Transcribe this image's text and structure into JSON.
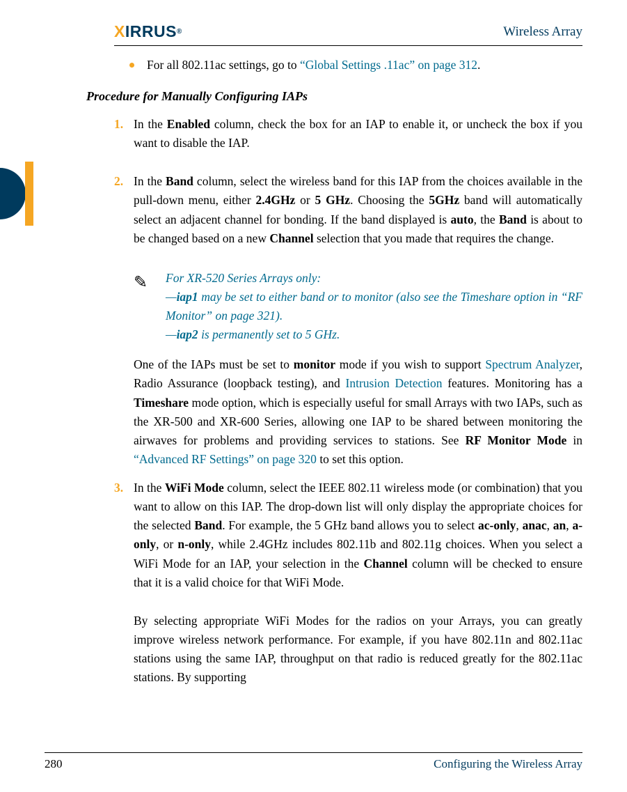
{
  "header": {
    "brand": "XIRRUS",
    "title": "Wireless Array"
  },
  "bullet1": {
    "prefix": "For all 802.11ac settings, go to ",
    "link": "“Global Settings .11ac” on page 312",
    "suffix": "."
  },
  "subhead": "Procedure for Manually Configuring IAPs",
  "step1": {
    "num": "1.",
    "t1": "In the ",
    "b1": "Enabled",
    "t2": " column, check the box for an IAP to enable it, or uncheck the box if you want to disable the IAP."
  },
  "step2": {
    "num": "2.",
    "t1": "In the ",
    "b1": "Band",
    "t2": " column, select the wireless band for this IAP from the choices available in the pull-down menu, either ",
    "b2": "2.4GHz",
    "t3": " or ",
    "b3": "5 GHz",
    "t4": ". Choosing the ",
    "b4": "5GHz",
    "t5": " band will automatically select an adjacent channel for bonding. If the band displayed is ",
    "b5": "auto",
    "t6": ", the ",
    "b6": "Band",
    "t7": " is about to be changed based on a new ",
    "b7": "Channel",
    "t8": " selection that you made that requires the change."
  },
  "note": {
    "l1": "For XR-520 Series Arrays only:",
    "l2a": "—",
    "l2b": "iap1",
    "l2c": " may be set to either band or to monitor (also see the Timeshare option in “RF Monitor” on page 321).",
    "l3a": "—",
    "l3b": "iap2",
    "l3c": " is permanently set to 5 GHz."
  },
  "p2b": {
    "t1": "One of the IAPs must be set to ",
    "b1": "monitor",
    "t2": " mode if you wish to support ",
    "l1": "Spectrum Analyzer",
    "t3": ", Radio Assurance (loopback testing), and ",
    "l2": "Intrusion Detection",
    "t4": " features. Monitoring has a ",
    "b2": "Timeshare",
    "t5": " mode option, which is especially useful for small Arrays with two IAPs, such as the XR-500 and XR-600 Series, allowing one IAP to be shared between monitoring the airwaves for problems and providing services to stations. See ",
    "b3": "RF Monitor Mode",
    "t6": " in ",
    "l3": "“Advanced RF Settings” on page 320",
    "t7": " to set this option."
  },
  "step3": {
    "num": "3.",
    "t1": "In the ",
    "b1": "WiFi Mode",
    "t2": " column, select the IEEE 802.11 wireless mode (or combination) that you want to allow on this IAP. The drop-down list will only display the appropriate choices for the selected ",
    "b2": "Band",
    "t3": ". For example, the 5 GHz band allows you to select ",
    "b3": "ac-only",
    "t4": ", ",
    "b4": "anac",
    "t5": ", ",
    "b5": "an",
    "t6": ", ",
    "b6": "a-only",
    "t7": ", or ",
    "b7": "n-only",
    "t8": ", while 2.4GHz includes 802.11b and 802.11g choices. When you select a WiFi Mode for an IAP, your selection in the ",
    "b8": "Channel",
    "t9": " column will be checked to ensure that it is a valid choice for that WiFi Mode."
  },
  "p3b": "By selecting appropriate WiFi Modes for the radios on your Arrays, you can greatly improve wireless network performance. For example, if you have 802.11n and 802.11ac stations using the same IAP, throughput on that radio is reduced greatly for the 802.11ac stations. By supporting",
  "footer": {
    "page": "280",
    "section": "Configuring the Wireless Array"
  }
}
